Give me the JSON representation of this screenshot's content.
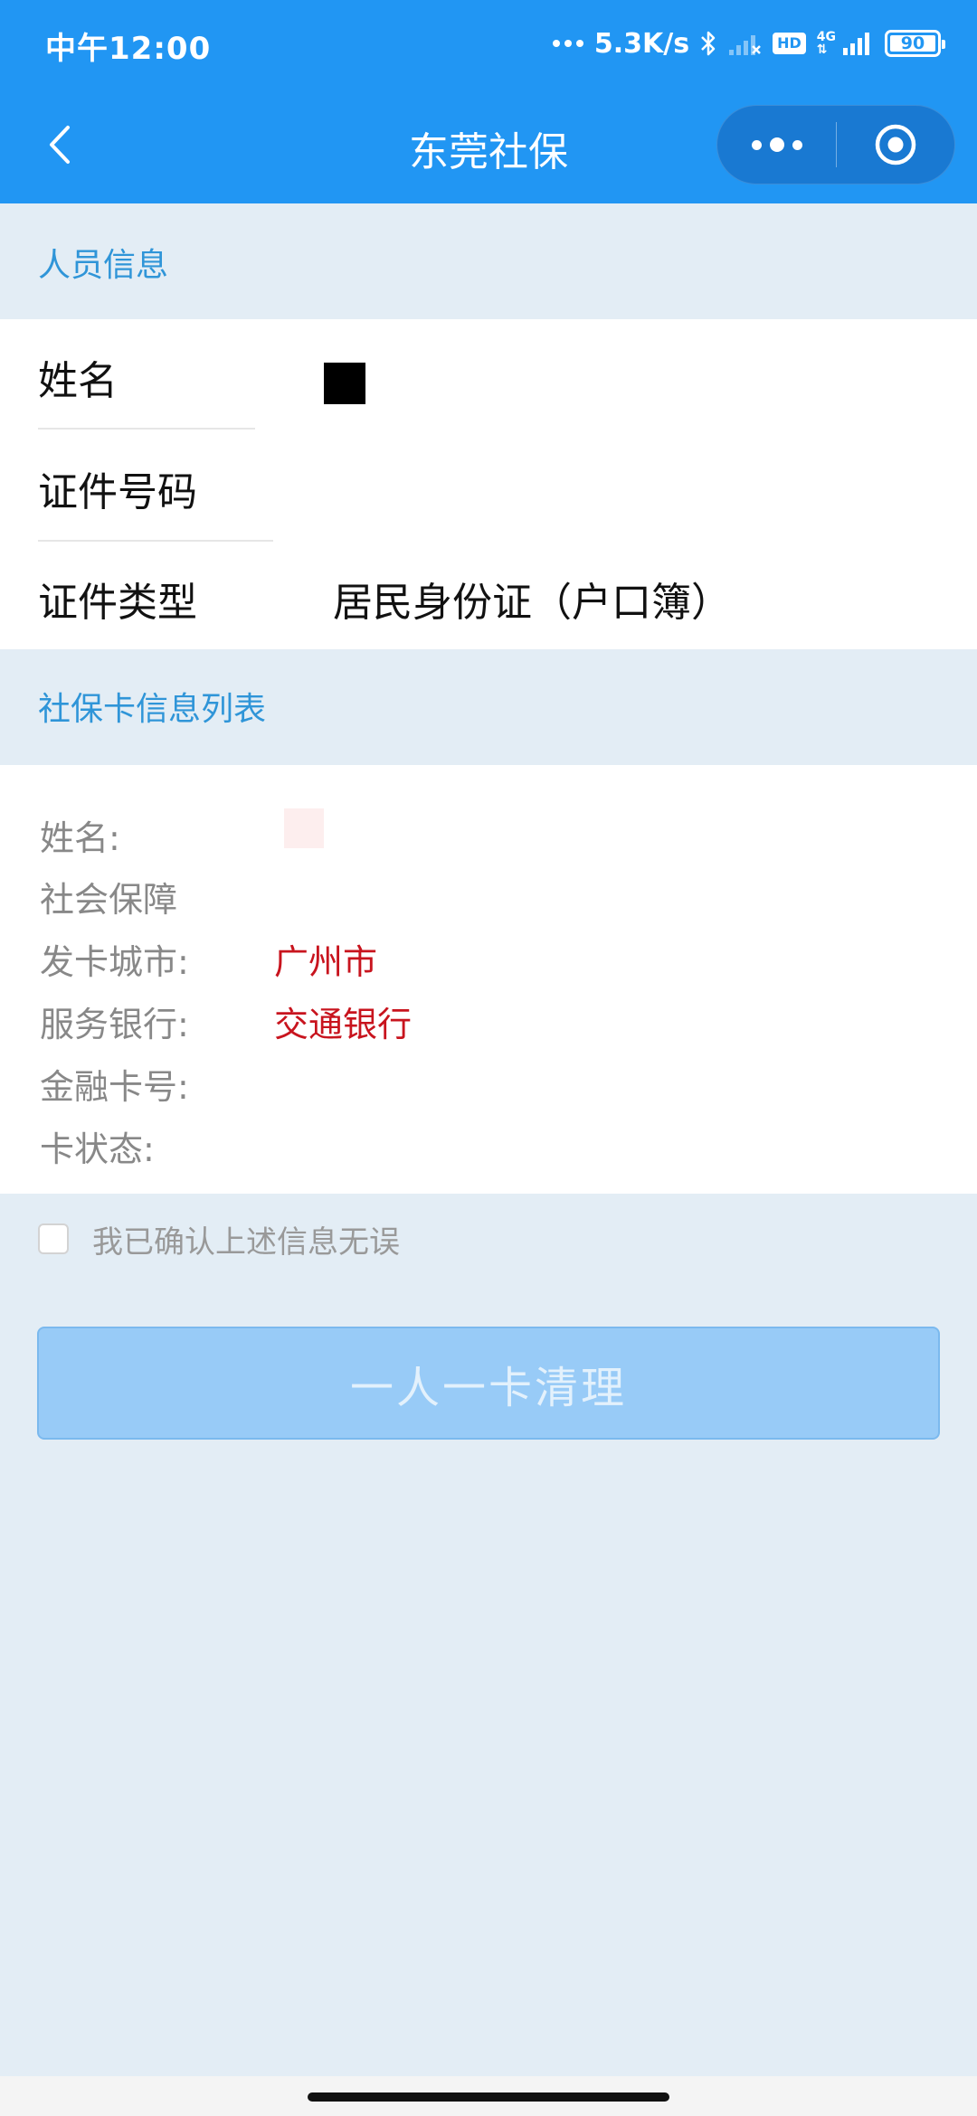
{
  "status_bar": {
    "time": "中午12:00",
    "net_speed": "5.3K/s",
    "hd_label": "HD",
    "net_type": "4G",
    "battery": "90"
  },
  "nav": {
    "title": "东莞社保"
  },
  "person_section": {
    "header": "人员信息",
    "name_label": "姓名",
    "id_number_label": "证件号码",
    "id_type_label": "证件类型",
    "id_type_value": "居民身份证（户口簿）"
  },
  "card_section": {
    "header": "社保卡信息列表",
    "name_label": "姓名:",
    "social_security_label": "社会保障",
    "city_label": "发卡城市:",
    "city_value": "广州市",
    "bank_label": "服务银行:",
    "bank_value": "交通银行",
    "card_number_label": "金融卡号:",
    "status_label": "卡状态:"
  },
  "confirm": {
    "checked": false,
    "text": "我已确认上述信息无误"
  },
  "action_button": {
    "label": "一人一卡清理"
  },
  "colors": {
    "primary": "#2196f3",
    "section_text": "#2f95d8",
    "value_red": "#c8141e",
    "button_disabled": "#98cbf7",
    "page_bg": "#e3edf5"
  }
}
